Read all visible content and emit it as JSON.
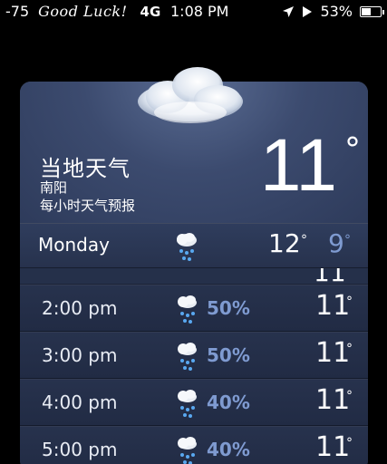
{
  "status_bar": {
    "signal": "-75",
    "carrier": "Good Luck!",
    "network": "4G",
    "time": "1:08 PM",
    "battery_percent": "53%",
    "battery_level": 0.53,
    "icons": [
      "location-arrow-icon",
      "play-icon",
      "battery-icon"
    ]
  },
  "weather": {
    "title": "当地天气",
    "city": "南阳",
    "subtitle": "每小时天气预报",
    "current_temp": "11",
    "degree": "°",
    "condition_icon": "cloud-icon",
    "day": {
      "name": "Monday",
      "icon": "rain-icon",
      "high": "12",
      "low": "9"
    },
    "partial_hour_temp": "11",
    "hours": [
      {
        "time": "2:00 pm",
        "icon": "rain-icon",
        "chance": "50%",
        "temp": "11"
      },
      {
        "time": "3:00 pm",
        "icon": "rain-icon",
        "chance": "50%",
        "temp": "11"
      },
      {
        "time": "4:00 pm",
        "icon": "rain-icon",
        "chance": "40%",
        "temp": "11"
      },
      {
        "time": "5:00 pm",
        "icon": "rain-icon",
        "chance": "40%",
        "temp": "11"
      }
    ]
  }
}
